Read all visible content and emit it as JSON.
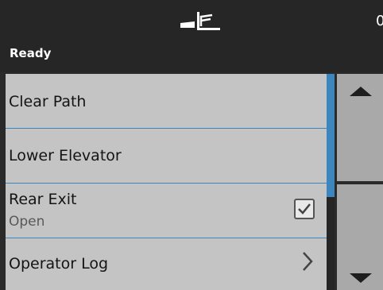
{
  "header": {
    "status": "Ready",
    "counter": "0",
    "icon": "paper-exit-tray-icon"
  },
  "menu": {
    "items": [
      {
        "label": "Clear Path"
      },
      {
        "label": "Lower Elevator"
      },
      {
        "label": "Rear Exit",
        "value": "Open",
        "control": "checkbox",
        "checked": true
      },
      {
        "label": "Operator Log",
        "control": "chevron",
        "icon": "chevron-right-icon"
      }
    ]
  },
  "scroll": {
    "up_icon": "arrow-up-icon",
    "down_icon": "arrow-down-icon"
  },
  "colors": {
    "header_background": "#262626",
    "list_background": "#c4c4c4",
    "accent": "#3c86c0",
    "scroll_button": "#a9a9a9"
  }
}
